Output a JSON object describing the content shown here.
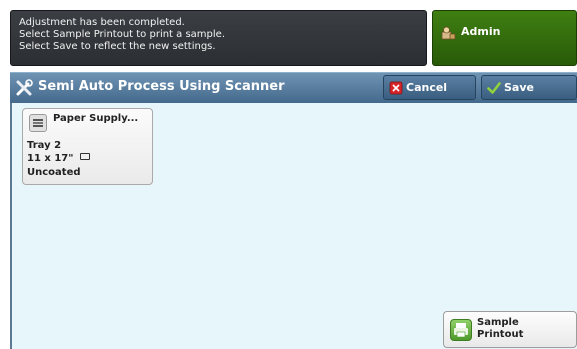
{
  "message": {
    "lines": [
      "Adjustment has been completed.",
      "Select Sample Printout to print a sample.",
      "Select Save to reflect the new settings."
    ]
  },
  "user": {
    "label": "Admin",
    "icon": "admin-user-icon"
  },
  "header": {
    "title": "Semi Auto Process Using Scanner",
    "icon": "tools-icon",
    "cancel_label": "Cancel",
    "save_label": "Save"
  },
  "paper_supply": {
    "title": "Paper Supply...",
    "tray": "Tray 2",
    "size": "11 x 17\"",
    "type": "Uncoated",
    "icon": "paper-tray-icon"
  },
  "sample_printout": {
    "label": "Sample Printout",
    "icon": "printer-icon"
  },
  "colors": {
    "header_blue": "#4f7699",
    "content_bg": "#e6f6fa",
    "admin_green": "#336e0c",
    "message_bg": "#33373b"
  }
}
